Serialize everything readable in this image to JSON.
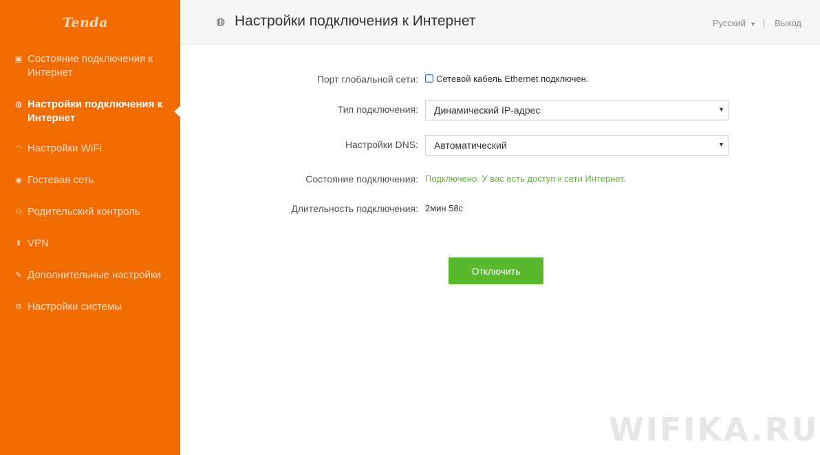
{
  "brand": {
    "logo": "Tenda"
  },
  "header": {
    "title": "Настройки подключения к Интернет",
    "title_icon": "globe-icon",
    "language": "Русский",
    "separator": "|",
    "logout": "Выход"
  },
  "sidebar": {
    "items": [
      {
        "label": "Состояние подключения к Интернет",
        "icon": "status-icon",
        "active": false
      },
      {
        "label": "Настройки подключения к Интернет",
        "icon": "globe-icon",
        "active": true
      },
      {
        "label": "Настройки WiFi",
        "icon": "wifi-icon",
        "active": false
      },
      {
        "label": "Гостевая сеть",
        "icon": "guest-icon",
        "active": false
      },
      {
        "label": "Родительский контроль",
        "icon": "parental-icon",
        "active": false
      },
      {
        "label": "VPN",
        "icon": "vpn-icon",
        "active": false
      },
      {
        "label": "Дополнительные настройки",
        "icon": "tools-icon",
        "active": false
      },
      {
        "label": "Настройки системы",
        "icon": "gear-icon",
        "active": false
      }
    ]
  },
  "form": {
    "wan_port": {
      "label": "Порт глобальной сети:",
      "value": "Сетевой кабель Ethernet подключен."
    },
    "connection_type": {
      "label": "Тип подключения:",
      "value": "Динамический IP-адрес"
    },
    "dns": {
      "label": "Настройки DNS:",
      "value": "Автоматический"
    },
    "status": {
      "label": "Состояние подключения:",
      "value": "Подключено. У вас есть доступ к сети Интернет."
    },
    "duration": {
      "label": "Длительность подключения:",
      "value": "2мин 58с"
    },
    "disconnect_button": "Отключить"
  },
  "watermark": "WIFIKA.RU",
  "colors": {
    "sidebar": "#f06c00",
    "button": "#5ab82d",
    "status_green": "#64b43c"
  }
}
